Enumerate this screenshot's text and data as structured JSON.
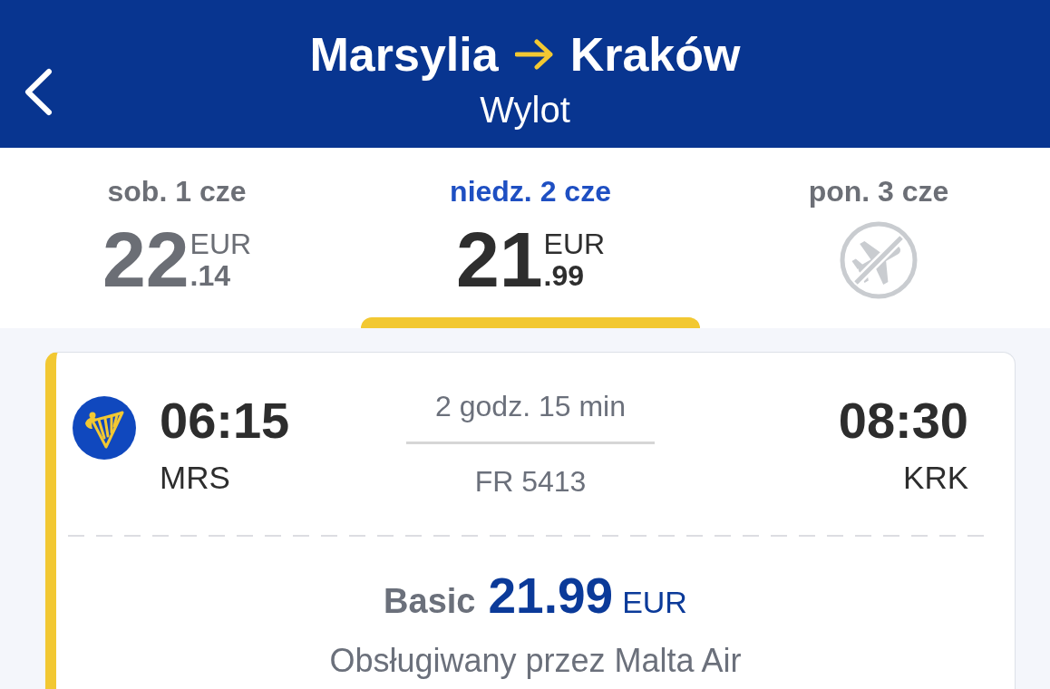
{
  "header": {
    "origin": "Marsylia",
    "destination": "Kraków",
    "subtitle": "Wylot"
  },
  "date_tabs": [
    {
      "kind": "fare",
      "date": "sob. 1 cze",
      "price_whole": "22",
      "price_cents": ".14",
      "currency": "EUR",
      "selected": false
    },
    {
      "kind": "fare",
      "date": "niedz. 2 cze",
      "price_whole": "21",
      "price_cents": ".99",
      "currency": "EUR",
      "selected": true
    },
    {
      "kind": "no_flights",
      "date": "pon. 3 cze",
      "selected": false
    }
  ],
  "flight": {
    "departure_time": "06:15",
    "departure_airport": "MRS",
    "duration": "2 godz. 15 min",
    "flight_number": "FR 5413",
    "arrival_time": "08:30",
    "arrival_airport": "KRK",
    "fare": {
      "name": "Basic",
      "price": "21.99",
      "currency": "EUR"
    },
    "operator": "Obsługiwany przez Malta Air"
  }
}
